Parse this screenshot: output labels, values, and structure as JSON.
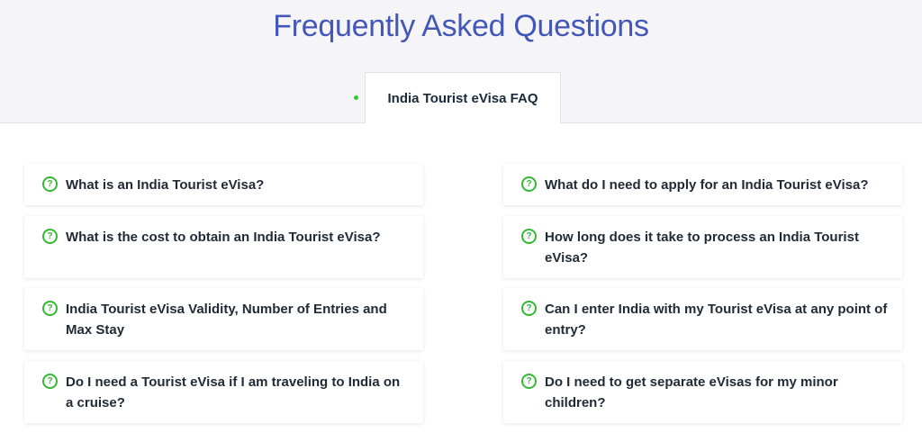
{
  "page": {
    "title": "Frequently Asked Questions"
  },
  "tabs": [
    {
      "label": "India Tourist eVisa FAQ",
      "active": true
    }
  ],
  "colors": {
    "title": "#4456b8",
    "accent": "#35b835",
    "text": "#1f2a36"
  },
  "faq": {
    "left": [
      {
        "question": "What is an India Tourist eVisa?"
      },
      {
        "question": "What is the cost to obtain an India Tourist eVisa?"
      },
      {
        "question": "India Tourist eVisa Validity, Number of Entries and Max Stay"
      },
      {
        "question": "Do I need a Tourist eVisa if I am traveling to India on a cruise?"
      }
    ],
    "right": [
      {
        "question": "What do I need to apply for an India Tourist eVisa?"
      },
      {
        "question": "How long does it take to process an India Tourist eVisa?"
      },
      {
        "question": "Can I enter India with my Tourist eVisa at any point of entry?"
      },
      {
        "question": "Do I need to get separate eVisas for my minor children?"
      }
    ]
  },
  "icons": {
    "question": "question-circle-icon"
  }
}
